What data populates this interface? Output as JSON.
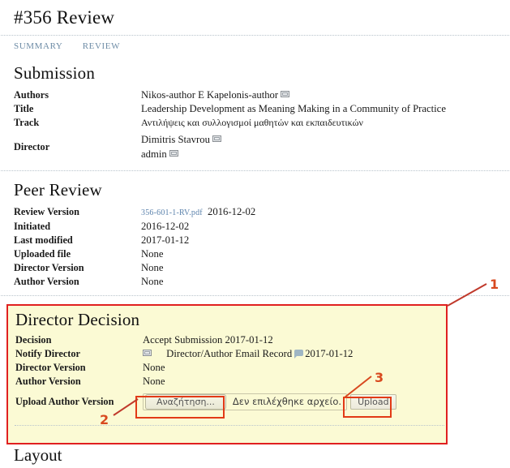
{
  "page": {
    "title": "#356 Review"
  },
  "tabs": [
    {
      "label": "SUMMARY",
      "name": "tab-summary"
    },
    {
      "label": "REVIEW",
      "name": "tab-review"
    }
  ],
  "submission": {
    "heading": "Submission",
    "rows": [
      {
        "label": "Authors",
        "value": "Nikos-author E Kapelonis-author",
        "icon": "envelope-icon"
      },
      {
        "label": "Title",
        "value": "Leadership Development as Meaning Making in a Community of Practice"
      },
      {
        "label": "Track",
        "value": "Αντιλήψεις και συλλογισμοί μαθητών και εκπαιδευτικών"
      },
      {
        "label": "Director",
        "value_line1": "Dimitris Stavrou",
        "value_line2": "admin"
      }
    ]
  },
  "peer_review": {
    "heading": "Peer Review",
    "rows": [
      {
        "label": "Review Version",
        "link": "356-601-1-RV.pdf",
        "value": "2016-12-02"
      },
      {
        "label": "Initiated",
        "value": "2016-12-02"
      },
      {
        "label": "Last modified",
        "value": "2017-01-12"
      },
      {
        "label": "Uploaded file",
        "value": "None"
      },
      {
        "label": "Director Version",
        "value": "None"
      },
      {
        "label": "Author Version",
        "value": "None"
      }
    ]
  },
  "director_decision": {
    "heading": "Director Decision",
    "rows": [
      {
        "label": "Decision",
        "value": "Accept Submission 2017-01-12"
      },
      {
        "label": "Notify Director",
        "record_label": "Director/Author Email Record",
        "value": "2017-01-12"
      },
      {
        "label": "Director Version",
        "value": "None"
      },
      {
        "label": "Author Version",
        "value": "None"
      },
      {
        "label": "Upload Author Version"
      }
    ],
    "upload": {
      "browse_label": "Αναζήτηση...",
      "file_status": "Δεν επιλέχθηκε αρχείο.",
      "upload_label": "Upload"
    }
  },
  "layout": {
    "heading": "Layout"
  },
  "annotations": [
    {
      "number": "1",
      "target": "director-decision-panel"
    },
    {
      "number": "2",
      "target": "browse-button"
    },
    {
      "number": "3",
      "target": "upload-button"
    }
  ],
  "colors": {
    "highlight_bg": "#fbfad4",
    "annotation_red": "#e02020",
    "annotation_orange": "#e23a16",
    "link_blue": "#5b82ac",
    "tab_blue": "#6e8ca6"
  }
}
